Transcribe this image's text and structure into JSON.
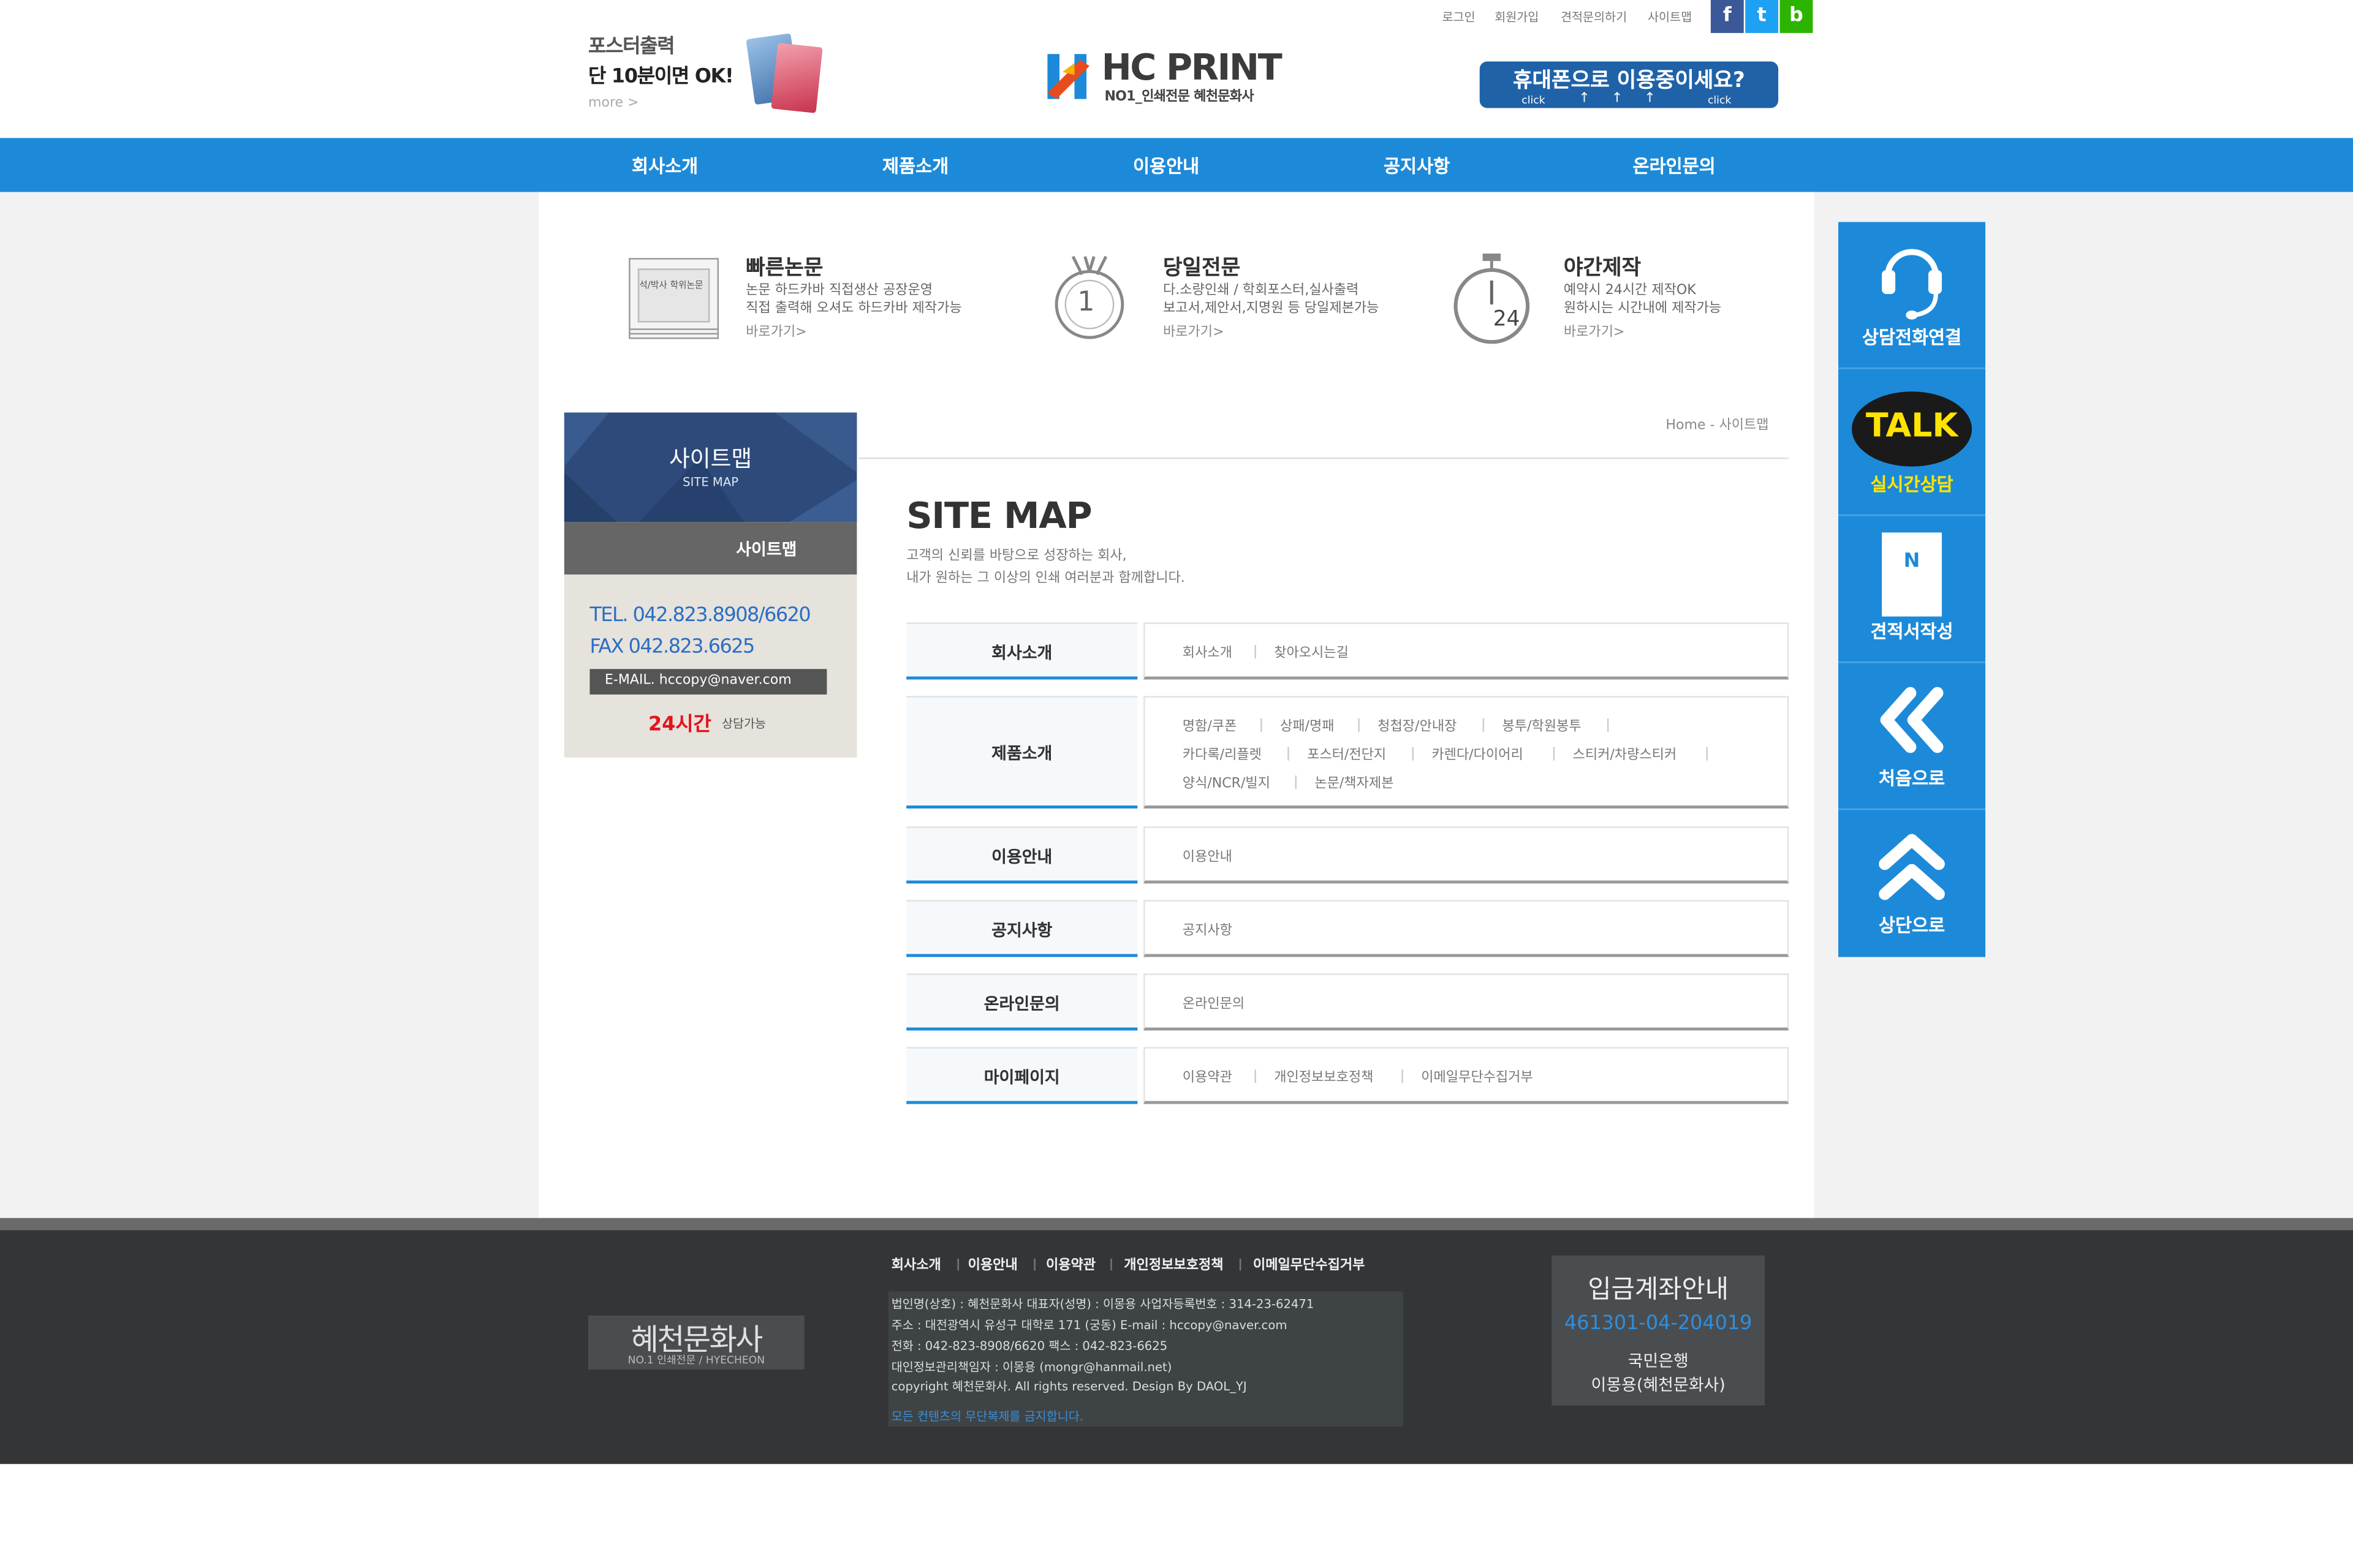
{
  "header": {
    "promo": {
      "line1": "포스터출력",
      "line2": "단 10분이면 OK!",
      "more": "more >"
    },
    "logo": {
      "name": "HC PRINT",
      "tagline": "NO1_인쇄전문 혜천문화사"
    },
    "util_links": [
      "로그인",
      "회원가입",
      "견적문의하기",
      "사이트맵"
    ],
    "sns": [
      {
        "label": "f",
        "color": "#3b5998"
      },
      {
        "label": "t",
        "color": "#1da1f2"
      },
      {
        "label": "b",
        "color": "#2db400"
      }
    ],
    "mobile_banner": {
      "text": "휴대폰으로 이용중이세요?",
      "click": "click"
    }
  },
  "nav": [
    "회사소개",
    "제품소개",
    "이용안내",
    "공지사항",
    "온라인문의"
  ],
  "features": [
    {
      "title": "빠른논문",
      "line1": "논문 하드카바 직접생산 공장운영",
      "line2": "직접 출력해 오셔도 하드카바 제작가능",
      "link": "바로가기>",
      "thumb": "석/박사 학위논문"
    },
    {
      "title": "당일전문",
      "line1": "다.소량인쇄 / 학회포스터,실사출력",
      "line2": "보고서,제안서,지명원 등 당일제본가능",
      "link": "바로가기>",
      "badge": "1"
    },
    {
      "title": "야간제작",
      "line1": "예약시 24시간 제작OK",
      "line2": "원하시는 시간내에 제작가능",
      "link": "바로가기>",
      "badge": "24"
    }
  ],
  "sidebar": {
    "title": "사이트맵",
    "title_en": "SITE MAP",
    "menu_item": "사이트맵",
    "tel": "TEL. 042.823.8908/6620",
    "fax": "FAX 042.823.6625",
    "email": "E-MAIL. hccopy@naver.com",
    "hours_highlight": "24시간",
    "hours_text": "상담가능"
  },
  "breadcrumb": "Home - 사이트맵",
  "sitemap": {
    "title": "SITE MAP",
    "desc1": "고객의 신뢰를 바탕으로 성장하는 회사,",
    "desc2": "내가 원하는 그 이상의 인쇄 여러분과 함께합니다.",
    "sections": [
      {
        "name": "회사소개",
        "links": [
          "회사소개",
          "찾아오시는길"
        ]
      },
      {
        "name": "제품소개",
        "links": [
          "명함/쿠폰",
          "상패/명패",
          "청첩장/안내장",
          "봉투/학원봉투",
          "카다록/리플렛",
          "포스터/전단지",
          "카렌다/다이어리",
          "스티커/차량스티커",
          "양식/NCR/빌지",
          "논문/책자제본"
        ]
      },
      {
        "name": "이용안내",
        "links": [
          "이용안내"
        ]
      },
      {
        "name": "공지사항",
        "links": [
          "공지사항"
        ]
      },
      {
        "name": "온라인문의",
        "links": [
          "온라인문의"
        ]
      },
      {
        "name": "마이페이지",
        "links": [
          "이용약관",
          "개인정보보호정책",
          "이메일무단수집거부"
        ]
      }
    ]
  },
  "quick_menu": [
    {
      "label": "상담전화연결",
      "icon": "headset-icon"
    },
    {
      "label": "실시간상담",
      "icon": "kakao-talk-icon",
      "icon_text": "TALK"
    },
    {
      "label": "견적서작성",
      "icon": "document-icon",
      "icon_text": "N"
    },
    {
      "label": "처음으로",
      "icon": "double-chevron-left-icon"
    },
    {
      "label": "상단으로",
      "icon": "double-chevron-up-icon"
    }
  ],
  "footer": {
    "logo": "혜천문화사",
    "logo_sub": "NO.1 인쇄전문 / HYECHEON",
    "nav": [
      "회사소개",
      "이용안내",
      "이용약관",
      "개인정보보호정책",
      "이메일무단수집거부"
    ],
    "info": [
      "법인명(상호) : 혜천문화사    대표자(성명) : 이몽용    사업자등록번호 : 314-23-62471",
      "주소 : 대전광역시 유성구 대학로 171 (궁동)          E-mail : hccopy@naver.com",
      "전화 : 042-823-8908/6620          팩스 : 042-823-6625",
      "대인정보관리책임자 : 이몽용 (mongr@hanmail.net)",
      "copyright 혜천문화사. All rights reserved. Design By DAOL_YJ"
    ],
    "notice": "모든 컨텐츠의 무단복제를 금지합니다.",
    "bank": {
      "title": "입금계좌안내",
      "account": "461301-04-204019",
      "bank": "국민은행",
      "holder": "이몽용(혜천문화사)"
    }
  },
  "colors": {
    "primary": "#1d8ad9",
    "dark": "#333537",
    "accent_red": "#e3141b",
    "navy": "#2d4a7a"
  }
}
